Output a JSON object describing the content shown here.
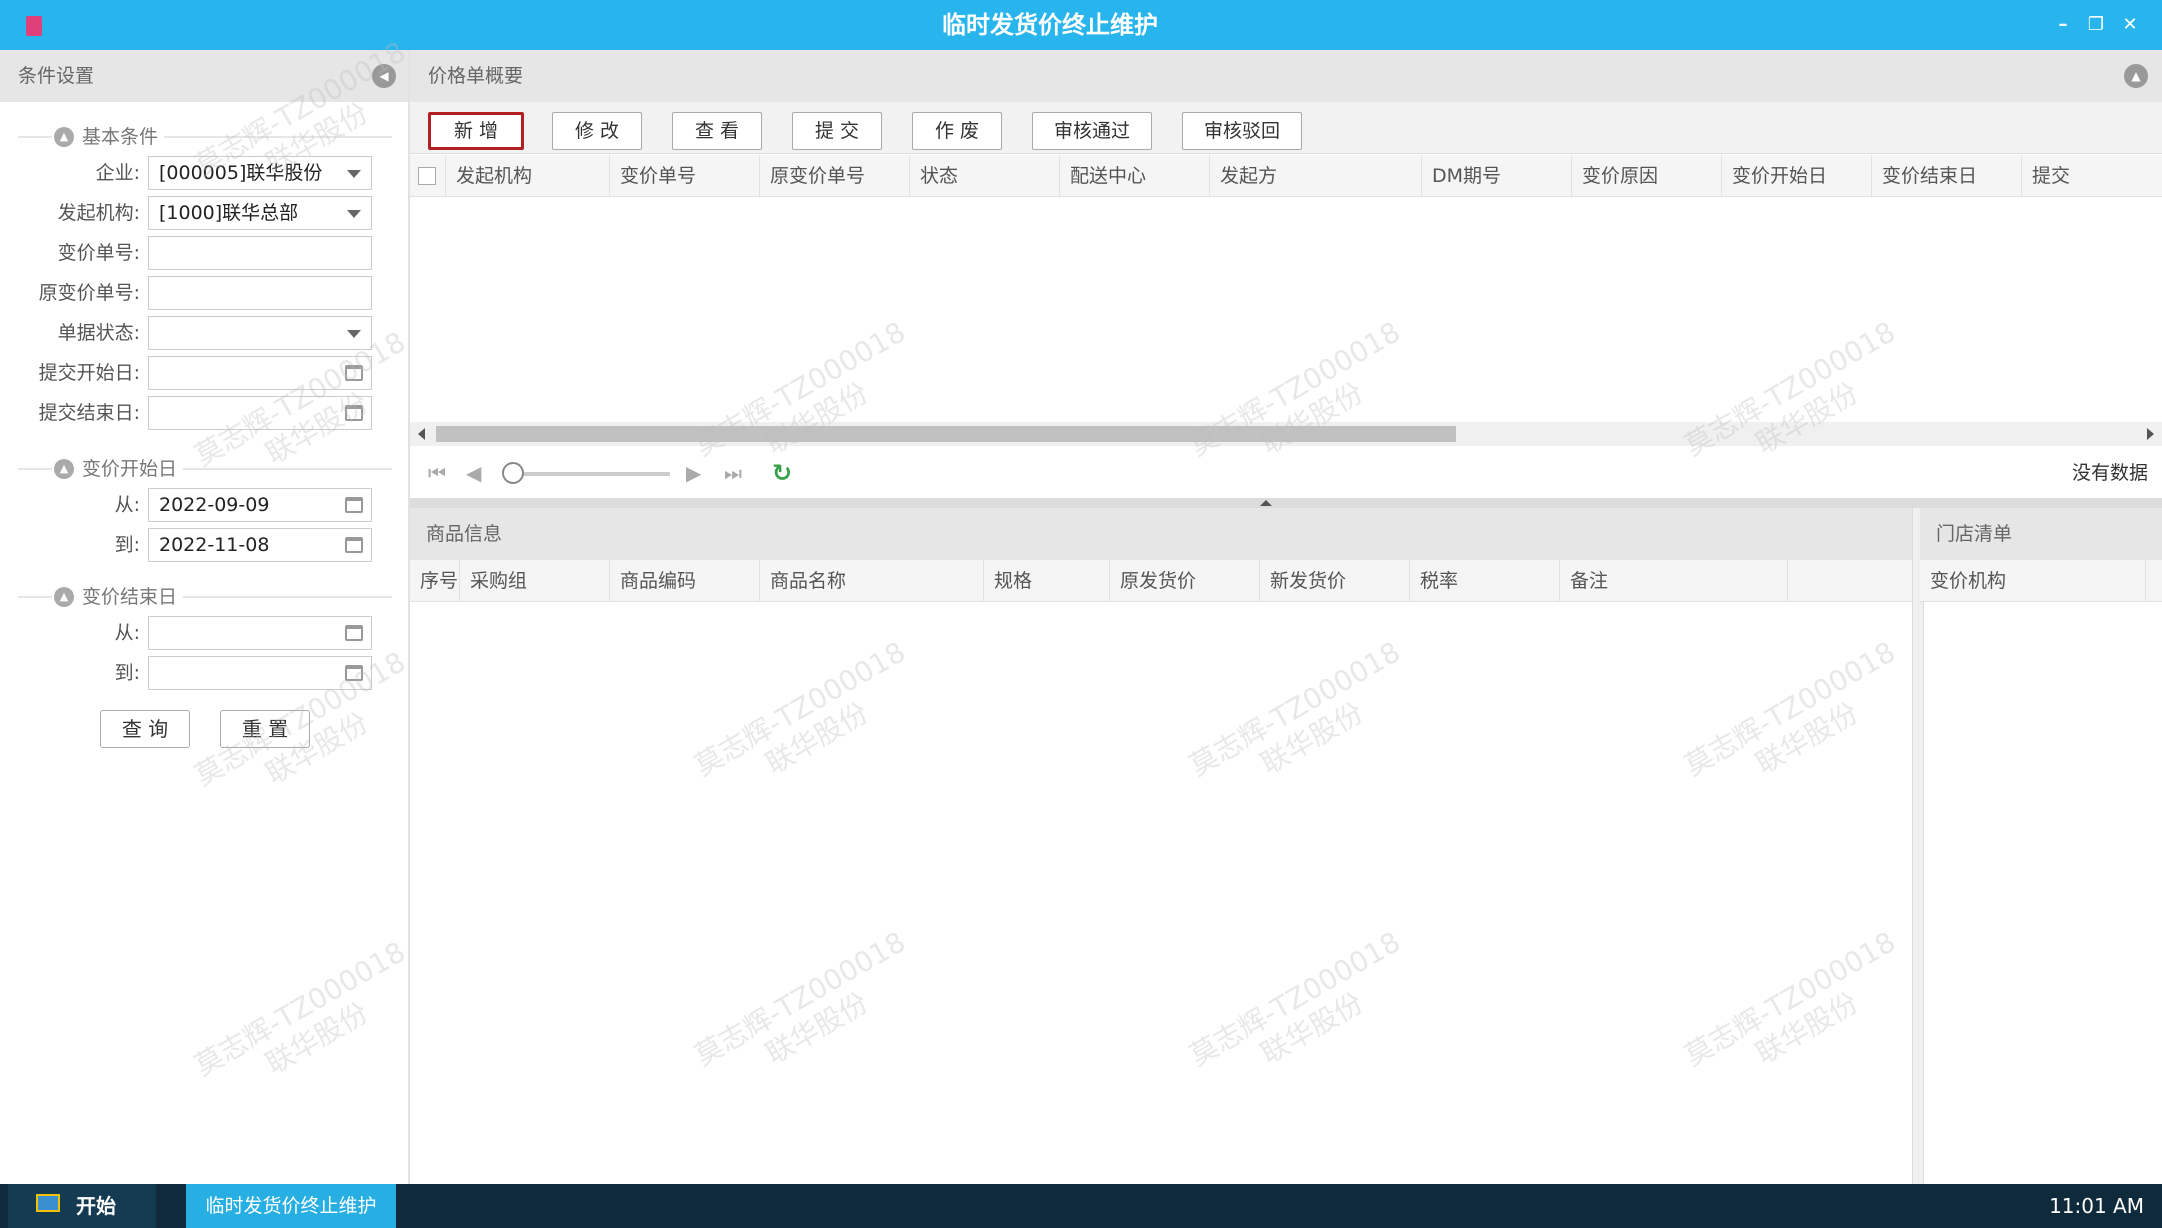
{
  "window": {
    "title": "临时发货价终止维护",
    "minimize": "–",
    "restore": "❐",
    "close": "✕"
  },
  "left_panel": {
    "title": "条件设置",
    "group_basic": "基本条件",
    "fields": {
      "company_label": "企业:",
      "company_value": "[000005]联华股份",
      "org_label": "发起机构:",
      "org_value": "[1000]联华总部",
      "doc_no_label": "变价单号:",
      "orig_doc_no_label": "原变价单号:",
      "status_label": "单据状态:",
      "submit_start_label": "提交开始日:",
      "submit_end_label": "提交结束日:"
    },
    "group_start": "变价开始日",
    "start_from_label": "从:",
    "start_from_value": "2022-09-09",
    "start_to_label": "到:",
    "start_to_value": "2022-11-08",
    "group_end": "变价结束日",
    "end_from_label": "从:",
    "end_to_label": "到:",
    "query_button": "查 询",
    "reset_button": "重 置"
  },
  "main": {
    "title": "价格单概要",
    "toolbar": {
      "add": "新 增",
      "edit": "修 改",
      "view": "查 看",
      "submit": "提 交",
      "void": "作 废",
      "approve": "审核通过",
      "reject": "审核驳回"
    },
    "grid_columns": [
      "发起机构",
      "变价单号",
      "原变价单号",
      "状态",
      "配送中心",
      "发起方",
      "DM期号",
      "变价原因",
      "变价开始日",
      "变价结束日",
      "提交"
    ],
    "pager": {
      "no_data": "没有数据"
    }
  },
  "goods": {
    "title": "商品信息",
    "columns": [
      "序号",
      "采购组",
      "商品编码",
      "商品名称",
      "规格",
      "原发货价",
      "新发货价",
      "税率",
      "备注"
    ]
  },
  "stores": {
    "title": "门店清单",
    "columns": [
      "变价机构"
    ]
  },
  "watermark": {
    "line1": "莫志辉-TZ000018",
    "line2": "联华股份"
  },
  "taskbar": {
    "start": "开始",
    "task": "临时发货价终止维护",
    "time": "11:01 AM"
  }
}
